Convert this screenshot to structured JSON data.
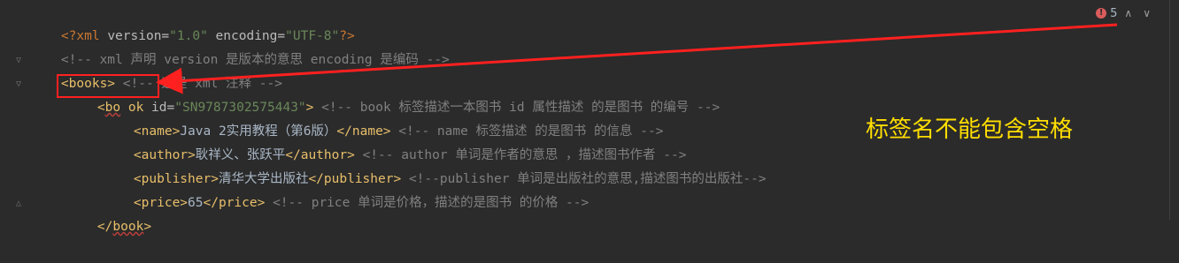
{
  "editor": {
    "inspection": {
      "count": "5"
    },
    "callout_text": "标签名不能包含空格",
    "lines": [
      {
        "pi_open": "<?xml ",
        "a1": "version=",
        "v1": "\"1.0\"",
        "sp": " ",
        "a2": "encoding=",
        "v2": "\"UTF-8\"",
        "pi_close": "?>"
      },
      {
        "comment": "<!-- xml 声明 version 是版本的意思 encoding 是编码 -->"
      },
      {
        "tag": "<books>",
        "comment": " <!-- 这是 xml 注释 -->"
      },
      {
        "tag_open": "<",
        "tag_bo": "bo",
        "tag_rest": " ok ",
        "attr": "id=",
        "val": "\"SN9787302575443\"",
        "tag_close": ">",
        "comment": " <!-- book 标签描述一本图书 id 属性描述 的是图书 的编号 -->"
      },
      {
        "tag_open": "<name>",
        "text": "Java 2实用教程（第6版）",
        "tag_close": "</name>",
        "comment": " <!-- name 标签描述 的是图书 的信息 -->"
      },
      {
        "tag_open": "<author>",
        "text": "耿祥义、张跃平",
        "tag_close": "</author>",
        "comment": " <!-- author 单词是作者的意思 ，描述图书作者 -->"
      },
      {
        "tag_open": "<publisher>",
        "text": "清华大学出版社",
        "tag_close": "</publisher>",
        "comment": " <!--publisher 单词是出版社的意思,描述图书的出版社-->"
      },
      {
        "tag_open": "<price>",
        "text": "65",
        "tag_close": "</price>",
        "comment": " <!-- price 单词是价格，描述的是图书 的价格 -->"
      },
      {
        "tag_open": "</",
        "tag_name": "book",
        "tag_close": ">"
      }
    ]
  },
  "colors": {
    "background": "#2b2b2b",
    "annotation_red": "#ff2020",
    "annotation_yellow": "#ffde00"
  }
}
